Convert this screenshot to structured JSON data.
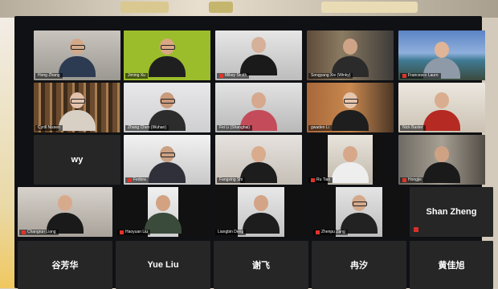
{
  "meeting": {
    "participants": [
      {
        "name": "Hong Zhang",
        "tile": "video"
      },
      {
        "name": "Jiming Xu",
        "tile": "video",
        "active_speaker": true
      },
      {
        "name": "Mikey Smith",
        "tile": "video"
      },
      {
        "name": "Songyang Xie (Winky)",
        "tile": "video"
      },
      {
        "name": "Francesco Lauro",
        "tile": "video"
      },
      {
        "name": "Cyrill Nissen",
        "tile": "video"
      },
      {
        "name": "Zhang Chen (Wuhan)",
        "tile": "video"
      },
      {
        "name": "Fei Li (Shanghai)",
        "tile": "video"
      },
      {
        "name": "gwaden Li",
        "tile": "video"
      },
      {
        "name": "Nick Baxter",
        "tile": "video"
      },
      {
        "name": "wy",
        "tile": "name"
      },
      {
        "name": "Fedora",
        "tile": "video"
      },
      {
        "name": "Fangxing Shi",
        "tile": "video"
      },
      {
        "name": "Ru Tian",
        "tile": "video"
      },
      {
        "name": "Hongjie",
        "tile": "video"
      },
      {
        "name": "Changrun Liang",
        "tile": "video"
      },
      {
        "name": "Haoyuan Liu",
        "tile": "video"
      },
      {
        "name": "Liangbin Deng",
        "tile": "video"
      },
      {
        "name": "Zhenpu Zang",
        "tile": "video"
      },
      {
        "name": "Shan Zheng",
        "tile": "name"
      },
      {
        "name": "谷芳华",
        "tile": "name"
      },
      {
        "name": "Yue Liu",
        "tile": "name"
      },
      {
        "name": "谢飞",
        "tile": "name"
      },
      {
        "name": "冉汐",
        "tile": "name"
      },
      {
        "name": "黄佳旭",
        "tile": "name"
      }
    ]
  },
  "colors": {
    "active_speaker_border": "#f1d400",
    "mute_icon": "#e0332c",
    "screen_background": "#101114"
  },
  "icons": {
    "muted": "muted-mic-icon"
  }
}
